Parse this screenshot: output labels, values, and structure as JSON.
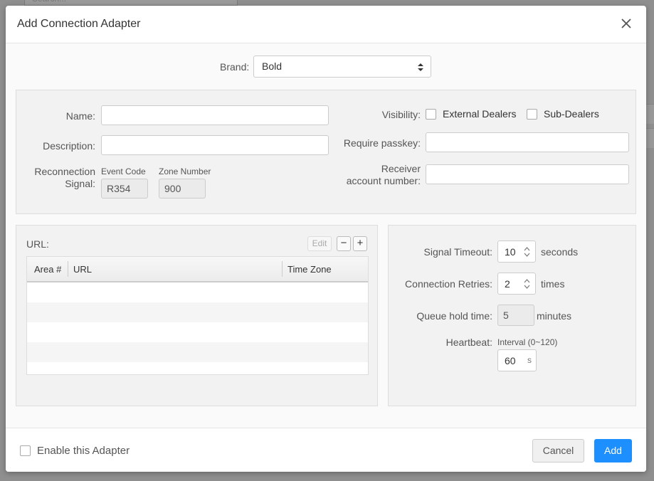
{
  "background": {
    "search_placeholder": "Search..."
  },
  "dialog": {
    "title": "Add Connection Adapter"
  },
  "brand": {
    "label": "Brand:",
    "selected": "Bold"
  },
  "general": {
    "name_label": "Name:",
    "name_value": "",
    "description_label": "Description:",
    "description_value": "",
    "reconnection_label_line1": "Reconnection",
    "reconnection_label_line2": "Signal:",
    "event_code_label": "Event Code",
    "event_code_value": "R354",
    "zone_number_label": "Zone Number",
    "zone_number_value": "900",
    "visibility_label": "Visibility:",
    "external_dealers_label": "External Dealers",
    "external_dealers_checked": false,
    "sub_dealers_label": "Sub-Dealers",
    "sub_dealers_checked": false,
    "passkey_label": "Require passkey:",
    "passkey_value": "",
    "receiver_label_line1": "Receiver",
    "receiver_label_line2": "account number:",
    "receiver_value": ""
  },
  "url_section": {
    "label": "URL:",
    "edit_label": "Edit",
    "remove_symbol": "−",
    "add_symbol": "+",
    "columns": [
      "Area #",
      "URL",
      "Time Zone"
    ],
    "rows": []
  },
  "timing": {
    "signal_timeout_label": "Signal Timeout:",
    "signal_timeout_value": "10",
    "signal_timeout_unit": "seconds",
    "retries_label": "Connection Retries:",
    "retries_value": "2",
    "retries_unit": "times",
    "queue_label": "Queue hold time:",
    "queue_value": "5",
    "queue_unit": "minutes",
    "heartbeat_label": "Heartbeat:",
    "interval_label": "Interval (0~120)",
    "interval_value": "60",
    "interval_unit": "s"
  },
  "footer": {
    "enable_label": "Enable this Adapter",
    "enable_checked": false,
    "cancel_label": "Cancel",
    "add_label": "Add"
  },
  "colors": {
    "primary": "#1e8fff",
    "overlay": "#8f8f8f"
  }
}
